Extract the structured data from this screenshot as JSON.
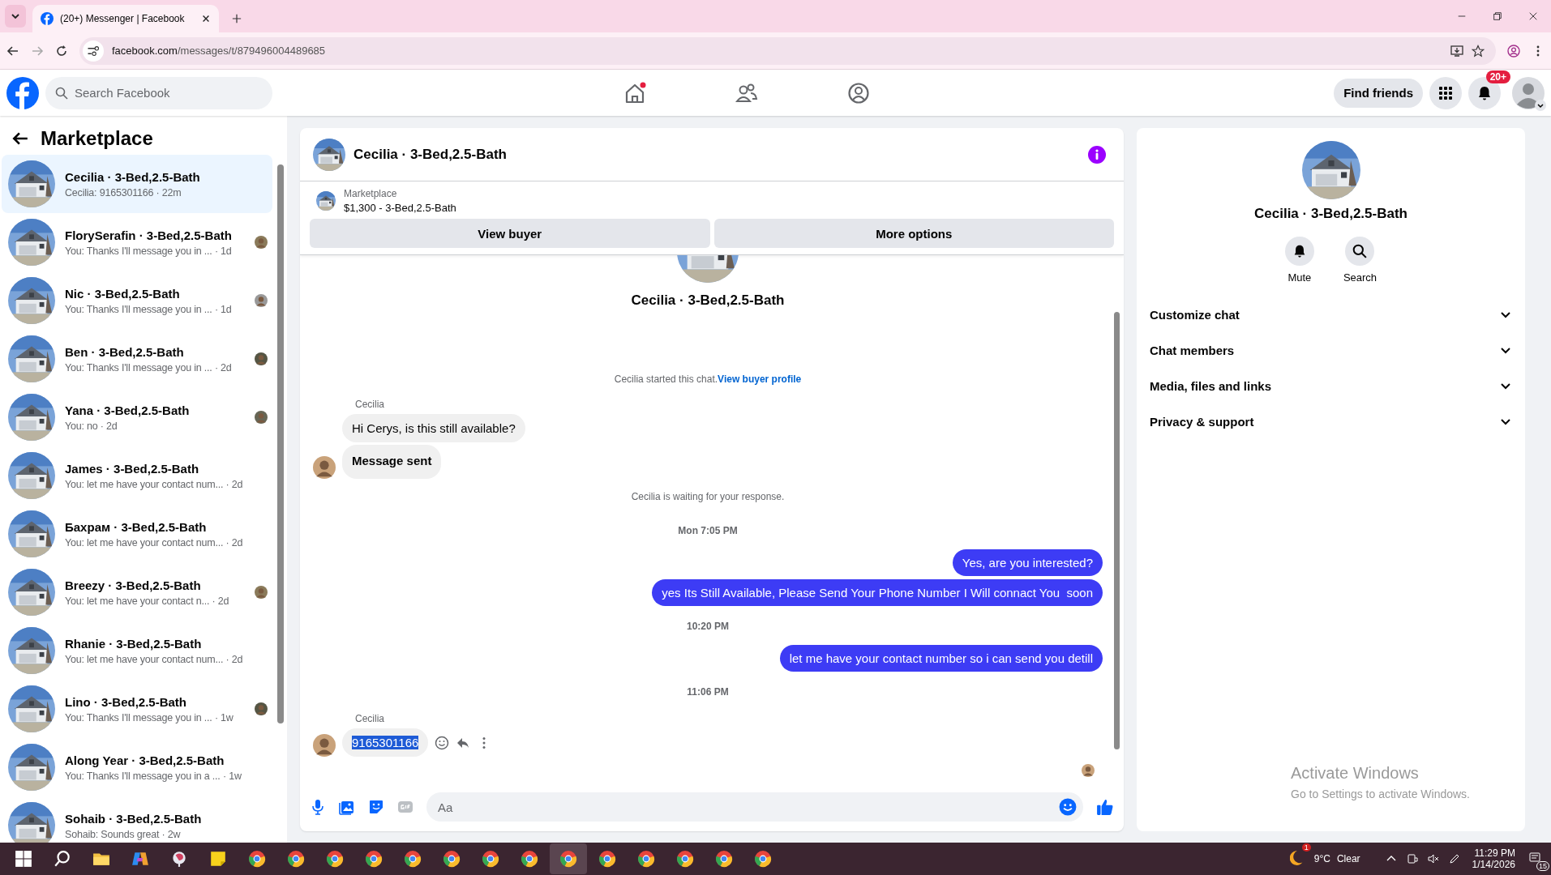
{
  "browser": {
    "tab_title": "(20+) Messenger | Facebook",
    "url_domain": "facebook.com",
    "url_path": "/messages/t/879496004489685"
  },
  "header": {
    "search_placeholder": "Search Facebook",
    "nav": [
      {
        "kind": "home",
        "badge": true
      },
      {
        "kind": "friends",
        "badge": false
      },
      {
        "kind": "groups",
        "badge": false
      }
    ],
    "find_friends": "Find friends",
    "notifications": "20+"
  },
  "sidebar": {
    "title": "Marketplace",
    "conversations": [
      {
        "name": "Cecilia · 3-Bed,2.5-Bath",
        "preview": "Cecilia: 9165301166 · 22m",
        "seen": false,
        "selected": true
      },
      {
        "name": "FlorySerafin · 3-Bed,2.5-Bath",
        "preview": "You: Thanks I'll message you in ... · 1d",
        "seen": true,
        "selected": false
      },
      {
        "name": "Nic · 3-Bed,2.5-Bath",
        "preview": "You: Thanks I'll message you in ... · 1d",
        "seen": true,
        "selected": false
      },
      {
        "name": "Ben · 3-Bed,2.5-Bath",
        "preview": "You: Thanks I'll message you in ... · 2d",
        "seen": true,
        "selected": false
      },
      {
        "name": "Yana · 3-Bed,2.5-Bath",
        "preview": "You: no · 2d",
        "seen": true,
        "selected": false
      },
      {
        "name": "James · 3-Bed,2.5-Bath",
        "preview": "You: let me have your contact num... · 2d",
        "seen": false,
        "selected": false
      },
      {
        "name": "Бахрам · 3-Bed,2.5-Bath",
        "preview": "You: let me have your contact num... · 2d",
        "seen": false,
        "selected": false
      },
      {
        "name": "Breezy · 3-Bed,2.5-Bath",
        "preview": "You: let me have your contact n... · 2d",
        "seen": true,
        "selected": false
      },
      {
        "name": "Rhanie · 3-Bed,2.5-Bath",
        "preview": "You: let me have your contact num... · 2d",
        "seen": false,
        "selected": false
      },
      {
        "name": "Lino · 3-Bed,2.5-Bath",
        "preview": "You: Thanks I'll message you in ... · 1w",
        "seen": true,
        "selected": false
      },
      {
        "name": "Along Year · 3-Bed,2.5-Bath",
        "preview": "You: Thanks I'll message you in a ... · 1w",
        "seen": false,
        "selected": false
      },
      {
        "name": "Sohaib · 3-Bed,2.5-Bath",
        "preview": "Sohaib: Sounds great · 2w",
        "seen": false,
        "selected": false
      }
    ]
  },
  "chat": {
    "title": "Cecilia · 3-Bed,2.5-Bath",
    "listing": {
      "label": "Marketplace",
      "price": "$1,300 - 3-Bed,2.5-Bath"
    },
    "buttons": [
      "View buyer",
      "More options"
    ],
    "intro_name": "Cecilia · 3-Bed,2.5-Bath",
    "messages": [
      {
        "kind": "system",
        "text": "Cecilia started this chat.",
        "link": "View buyer profile"
      },
      {
        "kind": "sender",
        "text": "Cecilia"
      },
      {
        "kind": "in",
        "text": "Hi Cerys, is this still available?",
        "avatar": false,
        "bold": false,
        "highlighted": false
      },
      {
        "kind": "in",
        "text": "Message sent",
        "avatar": true,
        "bold": true,
        "highlighted": false
      },
      {
        "kind": "system",
        "text": "Cecilia is waiting for your response."
      },
      {
        "kind": "time",
        "text": "Mon 7:05 PM"
      },
      {
        "kind": "out",
        "text": "Yes, are you interested?"
      },
      {
        "kind": "out",
        "text": "yes Its Still Available, Please Send Your Phone Number I Will connact You  soon"
      },
      {
        "kind": "time",
        "text": "10:20 PM"
      },
      {
        "kind": "out",
        "text": "let me have your contact number so i can send you detill"
      },
      {
        "kind": "time",
        "text": "11:06 PM"
      },
      {
        "kind": "sender",
        "text": "Cecilia"
      },
      {
        "kind": "in",
        "text": "9165301166",
        "avatar": true,
        "bold": false,
        "highlighted": true
      }
    ],
    "composer": {
      "placeholder": "Aa"
    }
  },
  "details": {
    "name": "Cecilia · 3-Bed,2.5-Bath",
    "actions": [
      {
        "kind": "mute",
        "label": "Mute"
      },
      {
        "kind": "search",
        "label": "Search"
      }
    ],
    "sections": [
      {
        "label": "Customize chat",
        "expanded": false
      },
      {
        "label": "Chat members",
        "expanded": false
      },
      {
        "label": "Media, files and links",
        "expanded": false
      },
      {
        "label": "Privacy & support",
        "expanded": false
      }
    ]
  },
  "activation": {
    "title": "Activate Windows",
    "hint": "Go to Settings to activate Windows."
  },
  "taskbar": {
    "apps": [
      {
        "kind": "start",
        "selected": false
      },
      {
        "kind": "search",
        "selected": false
      },
      {
        "kind": "folder",
        "selected": false
      },
      {
        "kind": "copilot",
        "selected": false
      },
      {
        "kind": "app",
        "selected": false
      },
      {
        "kind": "notes",
        "selected": false
      },
      {
        "kind": "browser",
        "selected": false
      },
      {
        "kind": "browser",
        "selected": false
      },
      {
        "kind": "browser",
        "selected": false
      },
      {
        "kind": "browser",
        "selected": false
      },
      {
        "kind": "browser",
        "selected": false
      },
      {
        "kind": "browser",
        "selected": false
      },
      {
        "kind": "browser",
        "selected": false
      },
      {
        "kind": "browser",
        "selected": false
      },
      {
        "kind": "browser",
        "selected": true
      },
      {
        "kind": "browser",
        "selected": false
      },
      {
        "kind": "browser",
        "selected": false
      },
      {
        "kind": "browser",
        "selected": false
      },
      {
        "kind": "browser",
        "selected": false
      },
      {
        "kind": "browser",
        "selected": false
      }
    ],
    "weather_badge": "1",
    "temperature": "9°C",
    "weather": "Clear",
    "time": "11:29 PM",
    "date": "1/14/2026",
    "notifications": "15"
  }
}
